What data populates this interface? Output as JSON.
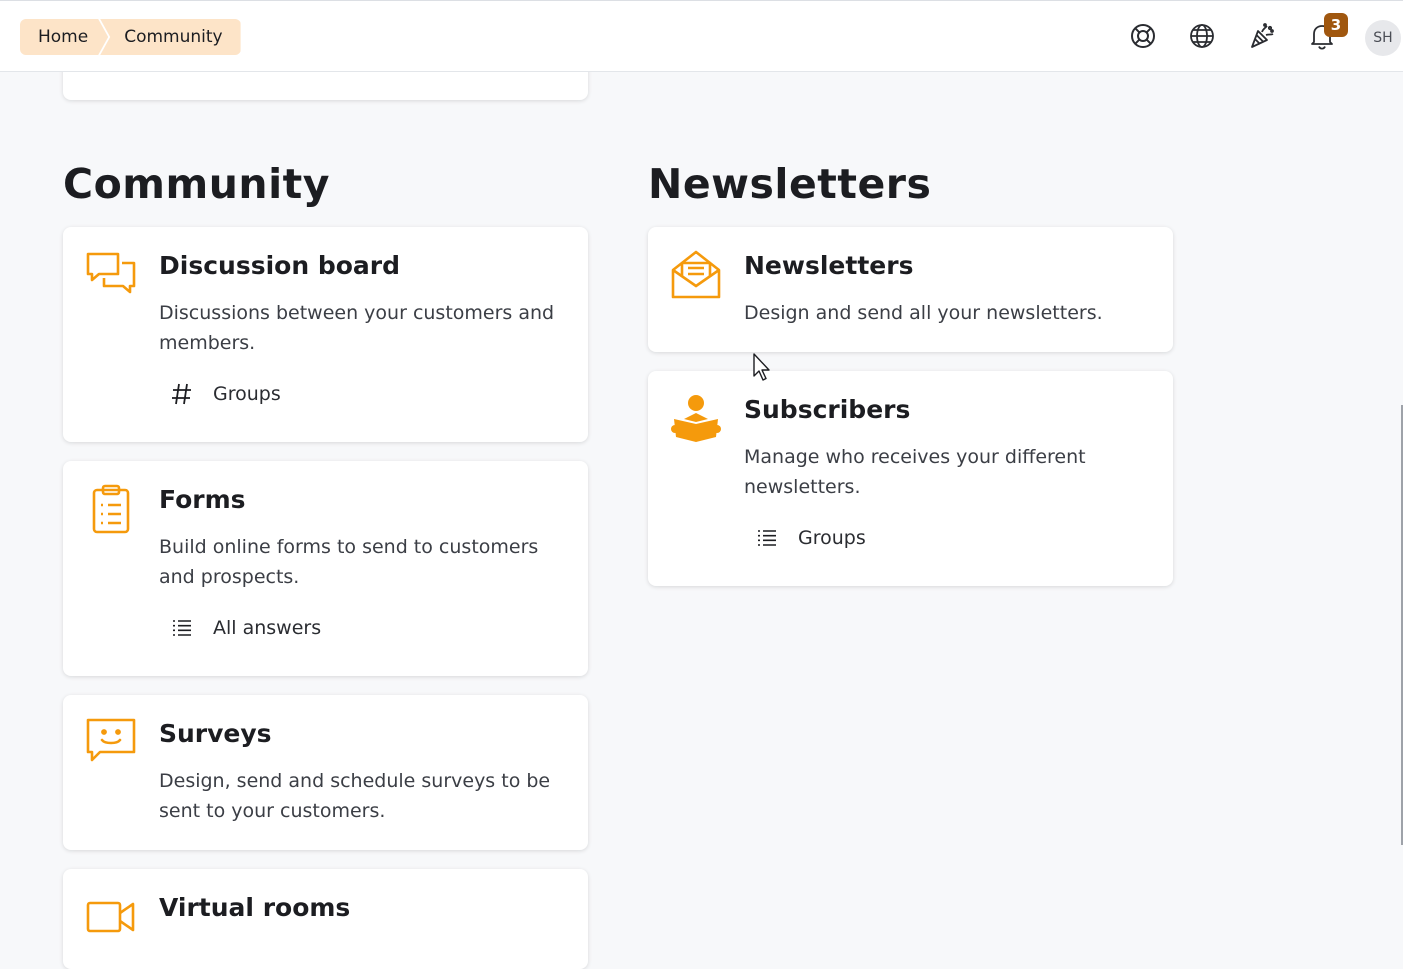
{
  "breadcrumb": {
    "home": "Home",
    "current": "Community"
  },
  "topbar": {
    "icons": [
      "lifebuoy-icon",
      "globe-icon",
      "party-popper-icon",
      "bell-icon"
    ],
    "notification_count": "3",
    "avatar_initials": "SH"
  },
  "colors": {
    "accent": "#f59a0c",
    "badge": "#a0570f",
    "crumb_bg": "#fde4c8"
  },
  "community": {
    "title": "Community",
    "cards": [
      {
        "title": "Discussion board",
        "description": "Discussions between your customers and members.",
        "icon": "chat-bubbles-icon",
        "link": {
          "label": "Groups",
          "icon": "hash-icon"
        }
      },
      {
        "title": "Forms",
        "description": "Build online forms to send to customers and prospects.",
        "icon": "clipboard-list-icon",
        "link": {
          "label": "All answers",
          "icon": "list-icon"
        }
      },
      {
        "title": "Surveys",
        "description": "Design, send and schedule surveys to be sent to your customers.",
        "icon": "smiley-chat-icon"
      },
      {
        "title": "Virtual rooms",
        "icon": "video-camera-icon"
      }
    ]
  },
  "newsletters": {
    "title": "Newsletters",
    "cards": [
      {
        "title": "Newsletters",
        "description": "Design and send all your newsletters.",
        "icon": "envelope-open-icon"
      },
      {
        "title": "Subscribers",
        "description": "Manage who receives your different newsletters.",
        "icon": "reader-icon",
        "link": {
          "label": "Groups",
          "icon": "list-icon"
        }
      }
    ]
  }
}
